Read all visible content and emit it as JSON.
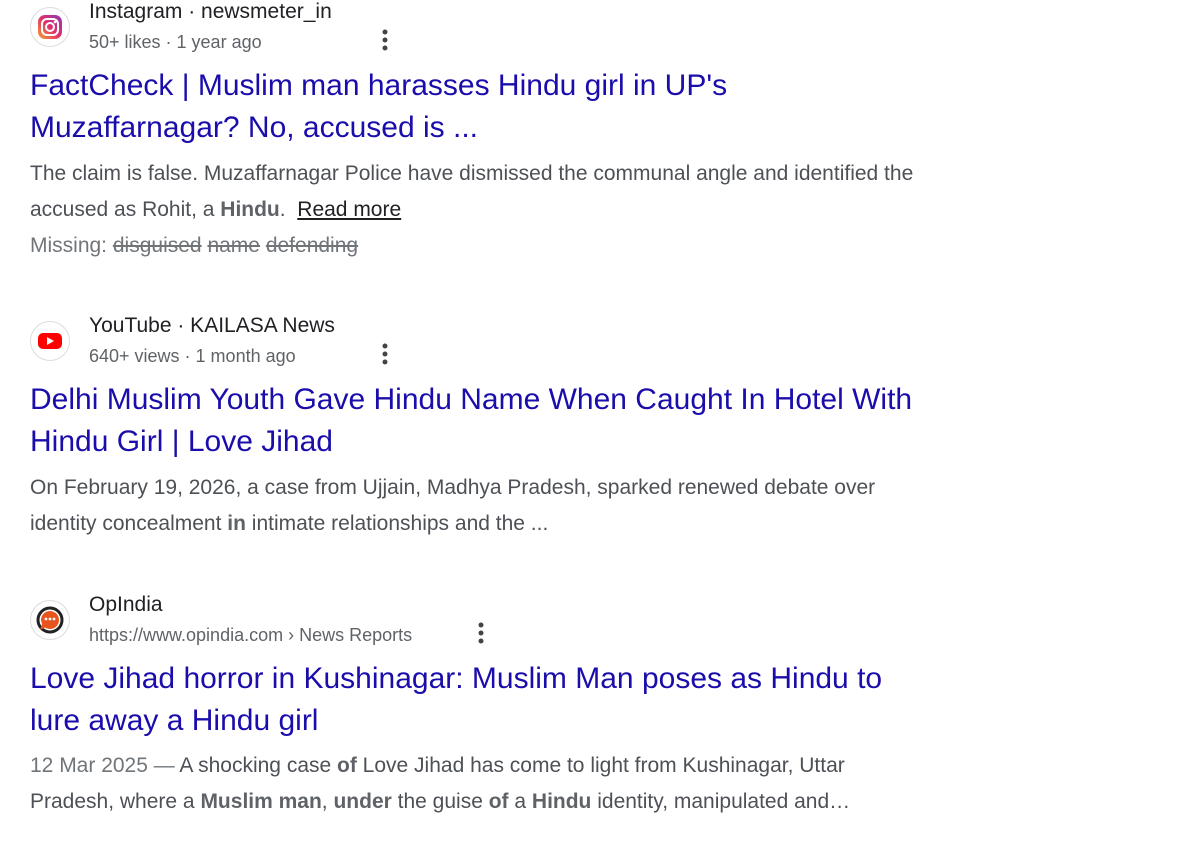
{
  "results": [
    {
      "source": "Instagram · newsmeter_in",
      "meta": "50+ likes · 1 year ago",
      "title_line1": "FactCheck | Muslim man harasses Hindu girl in UP's",
      "title_line2": "Muzaffarnagar? No, accused is ...",
      "snippet_line1": "The claim is false. Muzaffarnagar Police have dismissed the communal angle and identified the",
      "snippet_pre": "accused as Rohit, a ",
      "snippet_bold": "Hindu",
      "snippet_post": ".",
      "read_more": "Read more",
      "missing_label": "Missing:",
      "missing_terms": [
        "disguised",
        "name",
        "defending"
      ]
    },
    {
      "source": "YouTube · KAILASA News",
      "meta": "640+ views · 1 month ago",
      "title_line1": "Delhi Muslim Youth Gave Hindu Name When Caught In Hotel With",
      "title_line2": "Hindu Girl | Love Jihad",
      "snippet_line1": "On February 19, 2026, a case from Ujjain, Madhya Pradesh, sparked renewed debate over",
      "snippet_pre": "identity concealment ",
      "snippet_bold": "in",
      "snippet_post": " intimate relationships and the ..."
    },
    {
      "source": "OpIndia",
      "meta": "https://www.opindia.com › News Reports",
      "title_line1": "Love Jihad horror in Kushinagar: Muslim Man poses as Hindu to",
      "title_line2": "lure away a Hindu girl",
      "date": "12 Mar 2025 — ",
      "snippet_a": "A shocking case ",
      "snippet_b1": "of",
      "snippet_c": " Love Jihad has come to light from Kushinagar, Uttar",
      "snippet2_a": "Pradesh, where a ",
      "snippet2_b1": "Muslim man",
      "snippet2_c": ", ",
      "snippet2_b2": "under",
      "snippet2_d": " the guise ",
      "snippet2_b3": "of",
      "snippet2_e": " a ",
      "snippet2_b4": "Hindu",
      "snippet2_f": " identity, manipulated and…"
    }
  ],
  "icons": {
    "r0": "instagram-icon",
    "r1": "youtube-icon",
    "r2": "opindia-icon",
    "more": "more-vert-icon"
  },
  "colors": {
    "link": "#1a0dab",
    "snippet": "#4d5156",
    "meta": "#5f6368",
    "youtube_red": "#ff0000",
    "opindia_orange": "#e8541e"
  }
}
